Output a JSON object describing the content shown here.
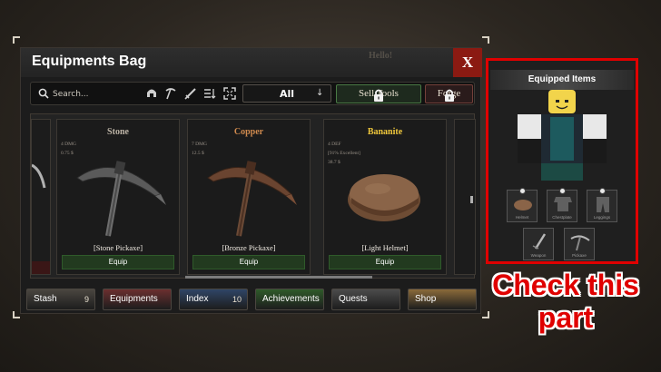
{
  "window": {
    "title": "Equipments Bag",
    "background_text": "Hello!",
    "close_label": "X"
  },
  "toolbar": {
    "search_placeholder": "Search...",
    "filter_icons": [
      "helmet-icon",
      "pickaxe-icon",
      "sword-icon",
      "sort-icon",
      "expand-icon"
    ],
    "dropdown_value": "All",
    "sell_label": "Sell Tools",
    "forge_label": "Forge"
  },
  "cards": [
    {
      "name": "Stone",
      "name_color": "#bfb6a8",
      "stats": [
        "4 DMG",
        "0.75 $"
      ],
      "item_label": "[Stone Pickaxe]",
      "equip_label": "Equip"
    },
    {
      "name": "Copper",
      "name_color": "#d08a4e",
      "stats": [
        "7 DMG",
        "12.5 $"
      ],
      "item_label": "[Bronze Pickaxe]",
      "equip_label": "Equip"
    },
    {
      "name": "Bananite",
      "name_color": "#f0c83c",
      "stats": [
        "4 DEF",
        "[91% Excellent]",
        "38.7 $"
      ],
      "item_label": "[Light Helmet]",
      "equip_label": "Equip"
    }
  ],
  "tabs": [
    {
      "label": "Stash",
      "count": "9",
      "color": "#4a4640"
    },
    {
      "label": "Equipments",
      "count": "",
      "color": "#6b2f2f"
    },
    {
      "label": "Index",
      "count": "10",
      "color": "#2f4566"
    },
    {
      "label": "Achievements",
      "count": "",
      "color": "#2f5a2a"
    },
    {
      "label": "Quests",
      "count": "",
      "color": "#4b4b4b"
    },
    {
      "label": "Shop",
      "count": "",
      "color": "#8a6a3a"
    }
  ],
  "equipped": {
    "title": "Equipped Items",
    "slots": [
      "Helmet",
      "Chestplate",
      "Leggings",
      "Weapon",
      "Pickaxe"
    ]
  },
  "callout": {
    "line1": "Check this",
    "line2": "part",
    "color": "#e00000"
  }
}
